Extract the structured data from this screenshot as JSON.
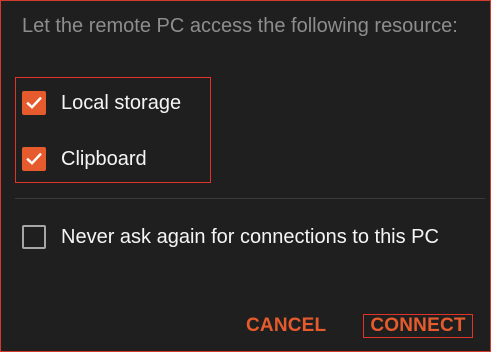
{
  "dialog": {
    "intro_text": "Let the remote PC access the following resource:",
    "options": [
      {
        "label": "Local storage",
        "checked": true
      },
      {
        "label": "Clipboard",
        "checked": true
      }
    ],
    "never_ask": {
      "label": "Never ask again for connections to this PC",
      "checked": false
    },
    "cancel_label": "CANCEL",
    "connect_label": "CONNECT"
  },
  "colors": {
    "accent": "#e55b2d",
    "highlight_border": "#e2332b",
    "background": "#1f1f1f",
    "intro_text": "#8d8d8d"
  },
  "icons": {
    "check": "check-icon"
  }
}
